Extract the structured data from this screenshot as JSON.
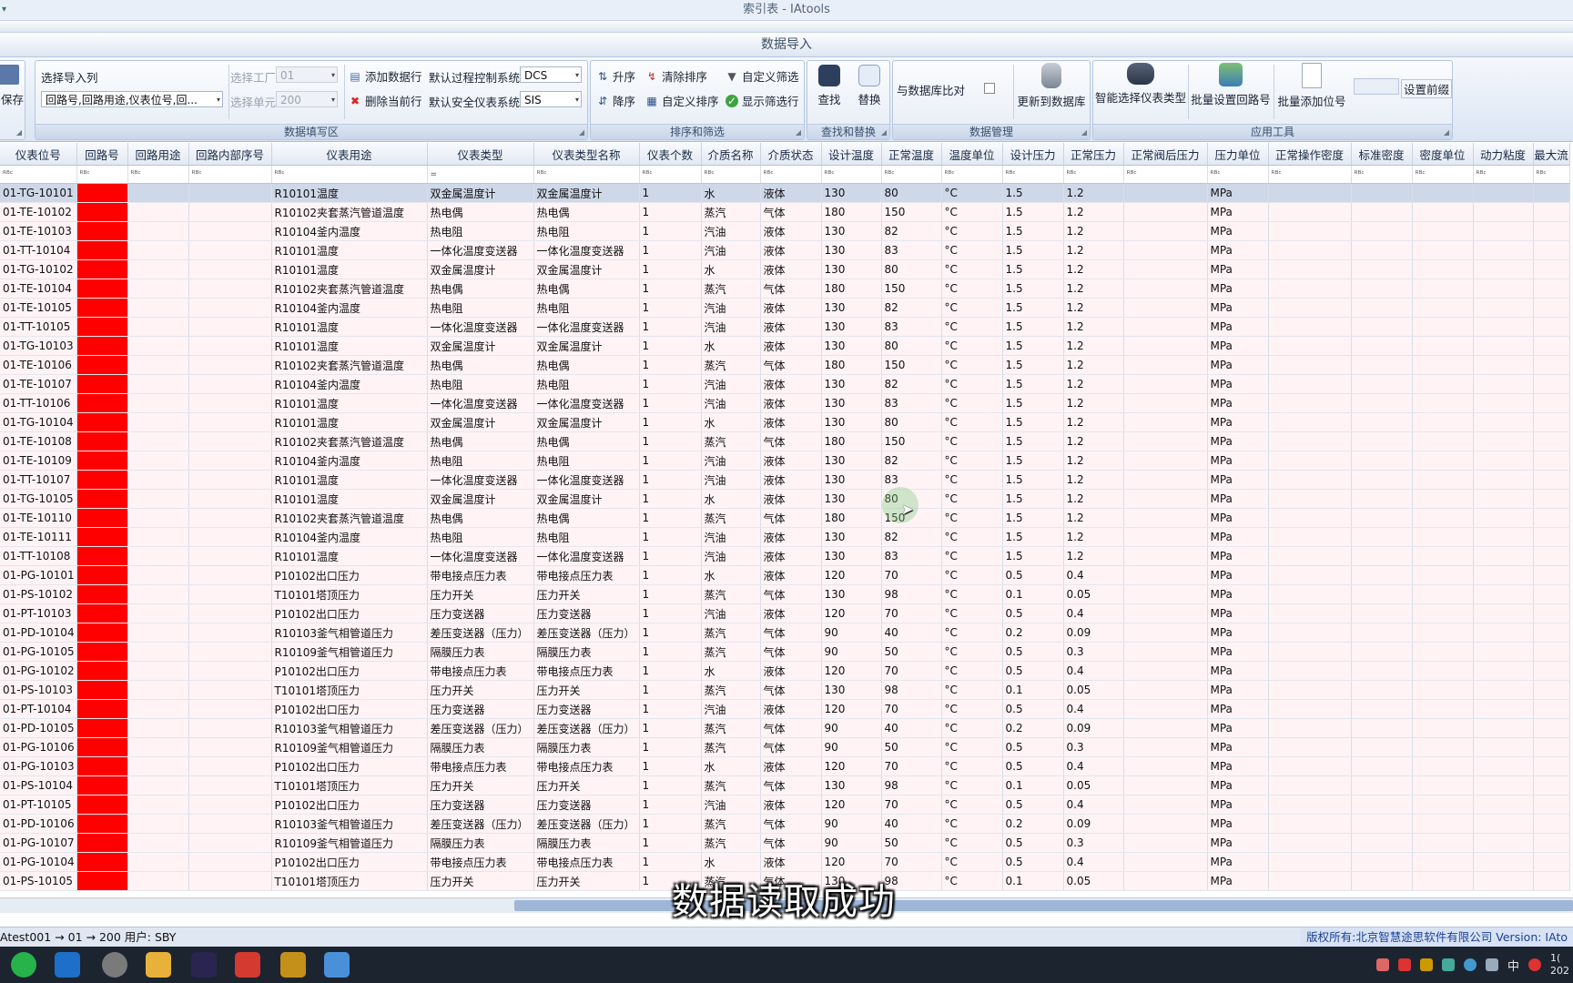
{
  "window": {
    "title": "索引表 - IAtools",
    "subtitle": "数据导入",
    "quick_access": "▾"
  },
  "ribbon": {
    "save_label": "保存",
    "fill_group": {
      "caption": "数据填写区",
      "select_columns_label": "选择导入列",
      "select_columns_value": "回路号,回路用途,仪表位号,回...",
      "select_factory_label": "选择工厂",
      "select_factory_value": "01",
      "select_unit_label": "选择单元",
      "select_unit_value": "200",
      "add_row_label": "添加数据行",
      "delete_row_label": "删除当前行",
      "default_process_label": "默认过程控制系统",
      "default_process_value": "DCS",
      "default_safety_label": "默认安全仪表系统",
      "default_safety_value": "SIS"
    },
    "sort_group": {
      "caption": "排序和筛选",
      "asc_label": "升序",
      "desc_label": "降序",
      "clear_sort_label": "清除排序",
      "custom_sort_label": "自定义排序",
      "custom_filter_label": "自定义筛选",
      "show_filter_label": "显示筛选行"
    },
    "find_group": {
      "caption": "查找和替换",
      "find_label": "查找",
      "replace_label": "替换"
    },
    "data_group": {
      "caption": "数据管理",
      "compare_label": "与数据库比对",
      "update_label": "更新到数据库"
    },
    "tools_group": {
      "caption": "应用工具",
      "smart_type_label": "智能选择仪表类型",
      "batch_loop_label": "批量设置回路号",
      "batch_tag_label": "批量添加位号",
      "prefix_value": "",
      "prefix_label": "设置前缀"
    }
  },
  "grid": {
    "columns": [
      "仪表位号",
      "回路号",
      "回路用途",
      "回路内部序号",
      "仪表用途",
      "仪表类型",
      "仪表类型名称",
      "仪表个数",
      "介质名称",
      "介质状态",
      "设计温度",
      "正常温度",
      "温度单位",
      "设计压力",
      "正常压力",
      "正常阀后压力",
      "压力单位",
      "正常操作密度",
      "标准密度",
      "密度单位",
      "动力粘度",
      "最大流"
    ],
    "filter_row": [
      "ᴿᴮᶜ",
      "ᴿᴮᶜ",
      "ᴿᴮᶜ",
      "ᴿᴮᶜ",
      "ᴿᴮᶜ",
      "=",
      "ᴿᴮᶜ",
      "ᴿᴮᶜ",
      "ᴿᴮᶜ",
      "ᴿᴮᶜ",
      "ᴿᴮᶜ",
      "ᴿᴮᶜ",
      "ᴿᴮᶜ",
      "ᴿᴮᶜ",
      "ᴿᴮᶜ",
      "ᴿᴮᶜ",
      "ᴿᴮᶜ",
      "ᴿᴮᶜ",
      "ᴿᴮᶜ",
      "ᴿᴮᶜ",
      "ᴿᴮᶜ",
      "ᴿᴮᶜ"
    ],
    "loop_cell_color": "#ff0000",
    "rows": [
      [
        "01-TG-10101",
        "",
        "",
        "",
        "R10101温度",
        "双金属温度计",
        "双金属温度计",
        "1",
        "水",
        "液体",
        "130",
        "80",
        "°C",
        "1.5",
        "1.2",
        "",
        "MPa",
        "",
        "",
        "",
        "",
        ""
      ],
      [
        "01-TE-10102",
        "",
        "",
        "",
        "R10102夹套蒸汽管道温度",
        "热电偶",
        "热电偶",
        "1",
        "蒸汽",
        "气体",
        "180",
        "150",
        "°C",
        "1.5",
        "1.2",
        "",
        "MPa",
        "",
        "",
        "",
        "",
        ""
      ],
      [
        "01-TE-10103",
        "",
        "",
        "",
        "R10104釜内温度",
        "热电阻",
        "热电阻",
        "1",
        "汽油",
        "液体",
        "130",
        "82",
        "°C",
        "1.5",
        "1.2",
        "",
        "MPa",
        "",
        "",
        "",
        "",
        ""
      ],
      [
        "01-TT-10104",
        "",
        "",
        "",
        "R10101温度",
        "一体化温度变送器",
        "一体化温度变送器",
        "1",
        "汽油",
        "液体",
        "130",
        "83",
        "°C",
        "1.5",
        "1.2",
        "",
        "MPa",
        "",
        "",
        "",
        "",
        ""
      ],
      [
        "01-TG-10102",
        "",
        "",
        "",
        "R10101温度",
        "双金属温度计",
        "双金属温度计",
        "1",
        "水",
        "液体",
        "130",
        "80",
        "°C",
        "1.5",
        "1.2",
        "",
        "MPa",
        "",
        "",
        "",
        "",
        ""
      ],
      [
        "01-TE-10104",
        "",
        "",
        "",
        "R10102夹套蒸汽管道温度",
        "热电偶",
        "热电偶",
        "1",
        "蒸汽",
        "气体",
        "180",
        "150",
        "°C",
        "1.5",
        "1.2",
        "",
        "MPa",
        "",
        "",
        "",
        "",
        ""
      ],
      [
        "01-TE-10105",
        "",
        "",
        "",
        "R10104釜内温度",
        "热电阻",
        "热电阻",
        "1",
        "汽油",
        "液体",
        "130",
        "82",
        "°C",
        "1.5",
        "1.2",
        "",
        "MPa",
        "",
        "",
        "",
        "",
        ""
      ],
      [
        "01-TT-10105",
        "",
        "",
        "",
        "R10101温度",
        "一体化温度变送器",
        "一体化温度变送器",
        "1",
        "汽油",
        "液体",
        "130",
        "83",
        "°C",
        "1.5",
        "1.2",
        "",
        "MPa",
        "",
        "",
        "",
        "",
        ""
      ],
      [
        "01-TG-10103",
        "",
        "",
        "",
        "R10101温度",
        "双金属温度计",
        "双金属温度计",
        "1",
        "水",
        "液体",
        "130",
        "80",
        "°C",
        "1.5",
        "1.2",
        "",
        "MPa",
        "",
        "",
        "",
        "",
        ""
      ],
      [
        "01-TE-10106",
        "",
        "",
        "",
        "R10102夹套蒸汽管道温度",
        "热电偶",
        "热电偶",
        "1",
        "蒸汽",
        "气体",
        "180",
        "150",
        "°C",
        "1.5",
        "1.2",
        "",
        "MPa",
        "",
        "",
        "",
        "",
        ""
      ],
      [
        "01-TE-10107",
        "",
        "",
        "",
        "R10104釜内温度",
        "热电阻",
        "热电阻",
        "1",
        "汽油",
        "液体",
        "130",
        "82",
        "°C",
        "1.5",
        "1.2",
        "",
        "MPa",
        "",
        "",
        "",
        "",
        ""
      ],
      [
        "01-TT-10106",
        "",
        "",
        "",
        "R10101温度",
        "一体化温度变送器",
        "一体化温度变送器",
        "1",
        "汽油",
        "液体",
        "130",
        "83",
        "°C",
        "1.5",
        "1.2",
        "",
        "MPa",
        "",
        "",
        "",
        "",
        ""
      ],
      [
        "01-TG-10104",
        "",
        "",
        "",
        "R10101温度",
        "双金属温度计",
        "双金属温度计",
        "1",
        "水",
        "液体",
        "130",
        "80",
        "°C",
        "1.5",
        "1.2",
        "",
        "MPa",
        "",
        "",
        "",
        "",
        ""
      ],
      [
        "01-TE-10108",
        "",
        "",
        "",
        "R10102夹套蒸汽管道温度",
        "热电偶",
        "热电偶",
        "1",
        "蒸汽",
        "气体",
        "180",
        "150",
        "°C",
        "1.5",
        "1.2",
        "",
        "MPa",
        "",
        "",
        "",
        "",
        ""
      ],
      [
        "01-TE-10109",
        "",
        "",
        "",
        "R10104釜内温度",
        "热电阻",
        "热电阻",
        "1",
        "汽油",
        "液体",
        "130",
        "82",
        "°C",
        "1.5",
        "1.2",
        "",
        "MPa",
        "",
        "",
        "",
        "",
        ""
      ],
      [
        "01-TT-10107",
        "",
        "",
        "",
        "R10101温度",
        "一体化温度变送器",
        "一体化温度变送器",
        "1",
        "汽油",
        "液体",
        "130",
        "83",
        "°C",
        "1.5",
        "1.2",
        "",
        "MPa",
        "",
        "",
        "",
        "",
        ""
      ],
      [
        "01-TG-10105",
        "",
        "",
        "",
        "R10101温度",
        "双金属温度计",
        "双金属温度计",
        "1",
        "水",
        "液体",
        "130",
        "80",
        "°C",
        "1.5",
        "1.2",
        "",
        "MPa",
        "",
        "",
        "",
        "",
        ""
      ],
      [
        "01-TE-10110",
        "",
        "",
        "",
        "R10102夹套蒸汽管道温度",
        "热电偶",
        "热电偶",
        "1",
        "蒸汽",
        "气体",
        "180",
        "150",
        "°C",
        "1.5",
        "1.2",
        "",
        "MPa",
        "",
        "",
        "",
        "",
        ""
      ],
      [
        "01-TE-10111",
        "",
        "",
        "",
        "R10104釜内温度",
        "热电阻",
        "热电阻",
        "1",
        "汽油",
        "液体",
        "130",
        "82",
        "°C",
        "1.5",
        "1.2",
        "",
        "MPa",
        "",
        "",
        "",
        "",
        ""
      ],
      [
        "01-TT-10108",
        "",
        "",
        "",
        "R10101温度",
        "一体化温度变送器",
        "一体化温度变送器",
        "1",
        "汽油",
        "液体",
        "130",
        "83",
        "°C",
        "1.5",
        "1.2",
        "",
        "MPa",
        "",
        "",
        "",
        "",
        ""
      ],
      [
        "01-PG-10101",
        "",
        "",
        "",
        "P10102出口压力",
        "带电接点压力表",
        "带电接点压力表",
        "1",
        "水",
        "液体",
        "120",
        "70",
        "°C",
        "0.5",
        "0.4",
        "",
        "MPa",
        "",
        "",
        "",
        "",
        ""
      ],
      [
        "01-PS-10102",
        "",
        "",
        "",
        "T10101塔顶压力",
        "压力开关",
        "压力开关",
        "1",
        "蒸汽",
        "气体",
        "130",
        "98",
        "°C",
        "0.1",
        "0.05",
        "",
        "MPa",
        "",
        "",
        "",
        "",
        ""
      ],
      [
        "01-PT-10103",
        "",
        "",
        "",
        "P10102出口压力",
        "压力变送器",
        "压力变送器",
        "1",
        "汽油",
        "液体",
        "120",
        "70",
        "°C",
        "0.5",
        "0.4",
        "",
        "MPa",
        "",
        "",
        "",
        "",
        ""
      ],
      [
        "01-PD-10104",
        "",
        "",
        "",
        "R10103釜气相管道压力",
        "差压变送器（压力）",
        "差压变送器（压力）",
        "1",
        "蒸汽",
        "气体",
        "90",
        "40",
        "°C",
        "0.2",
        "0.09",
        "",
        "MPa",
        "",
        "",
        "",
        "",
        ""
      ],
      [
        "01-PG-10105",
        "",
        "",
        "",
        "R10109釜气相管道压力",
        "隔膜压力表",
        "隔膜压力表",
        "1",
        "蒸汽",
        "气体",
        "90",
        "50",
        "°C",
        "0.5",
        "0.3",
        "",
        "MPa",
        "",
        "",
        "",
        "",
        ""
      ],
      [
        "01-PG-10102",
        "",
        "",
        "",
        "P10102出口压力",
        "带电接点压力表",
        "带电接点压力表",
        "1",
        "水",
        "液体",
        "120",
        "70",
        "°C",
        "0.5",
        "0.4",
        "",
        "MPa",
        "",
        "",
        "",
        "",
        ""
      ],
      [
        "01-PS-10103",
        "",
        "",
        "",
        "T10101塔顶压力",
        "压力开关",
        "压力开关",
        "1",
        "蒸汽",
        "气体",
        "130",
        "98",
        "°C",
        "0.1",
        "0.05",
        "",
        "MPa",
        "",
        "",
        "",
        "",
        ""
      ],
      [
        "01-PT-10104",
        "",
        "",
        "",
        "P10102出口压力",
        "压力变送器",
        "压力变送器",
        "1",
        "汽油",
        "液体",
        "120",
        "70",
        "°C",
        "0.5",
        "0.4",
        "",
        "MPa",
        "",
        "",
        "",
        "",
        ""
      ],
      [
        "01-PD-10105",
        "",
        "",
        "",
        "R10103釜气相管道压力",
        "差压变送器（压力）",
        "差压变送器（压力）",
        "1",
        "蒸汽",
        "气体",
        "90",
        "40",
        "°C",
        "0.2",
        "0.09",
        "",
        "MPa",
        "",
        "",
        "",
        "",
        ""
      ],
      [
        "01-PG-10106",
        "",
        "",
        "",
        "R10109釜气相管道压力",
        "隔膜压力表",
        "隔膜压力表",
        "1",
        "蒸汽",
        "气体",
        "90",
        "50",
        "°C",
        "0.5",
        "0.3",
        "",
        "MPa",
        "",
        "",
        "",
        "",
        ""
      ],
      [
        "01-PG-10103",
        "",
        "",
        "",
        "P10102出口压力",
        "带电接点压力表",
        "带电接点压力表",
        "1",
        "水",
        "液体",
        "120",
        "70",
        "°C",
        "0.5",
        "0.4",
        "",
        "MPa",
        "",
        "",
        "",
        "",
        ""
      ],
      [
        "01-PS-10104",
        "",
        "",
        "",
        "T10101塔顶压力",
        "压力开关",
        "压力开关",
        "1",
        "蒸汽",
        "气体",
        "130",
        "98",
        "°C",
        "0.1",
        "0.05",
        "",
        "MPa",
        "",
        "",
        "",
        "",
        ""
      ],
      [
        "01-PT-10105",
        "",
        "",
        "",
        "P10102出口压力",
        "压力变送器",
        "压力变送器",
        "1",
        "汽油",
        "液体",
        "120",
        "70",
        "°C",
        "0.5",
        "0.4",
        "",
        "MPa",
        "",
        "",
        "",
        "",
        ""
      ],
      [
        "01-PD-10106",
        "",
        "",
        "",
        "R10103釜气相管道压力",
        "差压变送器（压力）",
        "差压变送器（压力）",
        "1",
        "蒸汽",
        "气体",
        "90",
        "40",
        "°C",
        "0.2",
        "0.09",
        "",
        "MPa",
        "",
        "",
        "",
        "",
        ""
      ],
      [
        "01-PG-10107",
        "",
        "",
        "",
        "R10109釜气相管道压力",
        "隔膜压力表",
        "隔膜压力表",
        "1",
        "蒸汽",
        "气体",
        "90",
        "50",
        "°C",
        "0.5",
        "0.3",
        "",
        "MPa",
        "",
        "",
        "",
        "",
        ""
      ],
      [
        "01-PG-10104",
        "",
        "",
        "",
        "P10102出口压力",
        "带电接点压力表",
        "带电接点压力表",
        "1",
        "水",
        "液体",
        "120",
        "70",
        "°C",
        "0.5",
        "0.4",
        "",
        "MPa",
        "",
        "",
        "",
        "",
        ""
      ],
      [
        "01-PS-10105",
        "",
        "",
        "",
        "T10101塔顶压力",
        "压力开关",
        "压力开关",
        "1",
        "蒸汽",
        "气体",
        "130",
        "98",
        "°C",
        "0.1",
        "0.05",
        "",
        "MPa",
        "",
        "",
        "",
        "",
        ""
      ]
    ]
  },
  "status": {
    "left": "Atest001 → 01 → 200 用户: SBY",
    "right": "版权所有:北京智慧途思软件有限公司  Version: IAto"
  },
  "overlay_caption": "数据读取成功",
  "taskbar": {
    "tray_time": "1(",
    "tray_year": "202",
    "ime_label": "中"
  }
}
